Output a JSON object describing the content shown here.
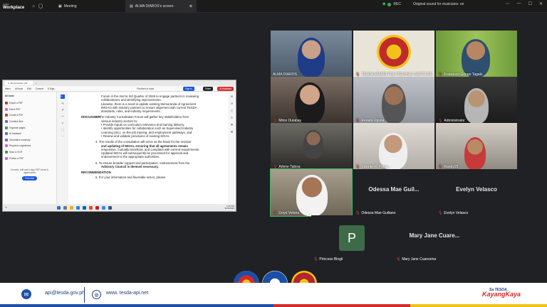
{
  "topbar": {
    "brand_line1": "zoom",
    "brand_line2": "Workplace",
    "tab_meeting": "Meeting",
    "tab_screen": "ALMA DIAROS's screen",
    "rec_label": "REC",
    "sound": "Original sound for musicians: on",
    "colors": {
      "rec": "#38b24d"
    }
  },
  "share": {
    "browser_tab": "A. Memorandum (All ...",
    "menu": [
      "Menu",
      "All tools",
      "Edit",
      "Convert",
      "E-Sign"
    ],
    "print_label": "Find text or tools",
    "sign_in": "Sign in",
    "share_btn": "Share",
    "ai_btn": "AI Assistant",
    "tools_header": "All tools",
    "tools": [
      "Export a PDF",
      "Edit a PDF",
      "Create a PDF",
      "Combine files",
      "Organize pages",
      "AI Assistant",
      "Generative summary",
      "Request e-signatures",
      "Scan & OCR",
      "Protect a PDF"
    ],
    "promo": "Convert, edit and e-sign PDF forms & agreements",
    "free_trial": "Free trial",
    "doc": {
      "line1": "Forum in the 2nd to 3rd Quarter of 2026 to engage partners in reviewing",
      "line2": "collaborations and identifying improvements.",
      "line3": "Likewise, there is a need to update existing Memoranda of Agreement",
      "line4": "(MOAs) with industry partners to ensure alignment with current TESDA",
      "line5": "standards, roles, and industry requirements.",
      "discussion": "DISCUSSION",
      "d1": "3. The Industry Consultation Forum will gather key stakeholders from",
      "d2": "various industry sectors to:",
      "d3": "•  Provide inputs on curriculum relevance and training delivery,",
      "d4": "•  Identify opportunities for collaboration such as Supervised Industry",
      "d5": "   Learning (SIL), on-the-job training, and employment pathways, and",
      "d6": "•  Review and validate provisions of existing MOAs.",
      "e1": "4. The results of the consultation will serve as the basis for the revision",
      "e2": "and updating of MOAs, ensuring that all agreements remain",
      "e3": "responsive, mutually beneficial, and compliant with current requirements.",
      "e4": "Updated MOAs will subsequently be processed for approval and",
      "e5": "endorsement to the appropriate authorities.",
      "f1": "5. To ensure broader support and participation, endorsement from the",
      "f2": "Advisory Council is deemed necessary.",
      "recommendation": "RECOMMENDATION",
      "g1": "6. For your information and favorable action, please."
    },
    "taskbar_time": "4:15 PM",
    "taskbar_date": "9/25/2025"
  },
  "participants": [
    {
      "name": "ALMA DIAROS",
      "muted": false
    },
    {
      "name": "TESDA APARRI POLYTECHNIC INSTITUTE",
      "muted": true
    },
    {
      "name": "Francisco Gringo Tagalo",
      "muted": true
    },
    {
      "name": "Mitos Dulabay",
      "muted": true
    },
    {
      "name": "Renato Ugsna",
      "muted": true
    },
    {
      "name": "Administrator",
      "muted": true
    },
    {
      "name": "Arlene Tabisa",
      "muted": true
    },
    {
      "name": "Vicente R. Palqu...",
      "muted": true
    },
    {
      "name": "Randy25",
      "muted": true
    },
    {
      "name": "Lloyd Veloria",
      "muted": true
    },
    {
      "name": "Odessa Mae Guiliano",
      "display": "Odessa Mae Guil...",
      "muted": true
    },
    {
      "name": "Evelyn Velasco",
      "display": "Evelyn Velasco",
      "muted": true
    },
    {
      "name": "Princess Bingil",
      "initial": "P",
      "muted": true
    },
    {
      "name": "Mary Jane Cuaresma",
      "display": "Mary Jane Cuare...",
      "muted": true
    }
  ],
  "footer": {
    "email": "api@tesda.gov.ph",
    "website": "www. tesda-api.net",
    "slogan_small": "Sa TESDA,",
    "slogan": "KayangKaya",
    "colors": {
      "blue": "#1e4fa8",
      "red": "#d52a2a",
      "yellow": "#f2c21b"
    }
  }
}
